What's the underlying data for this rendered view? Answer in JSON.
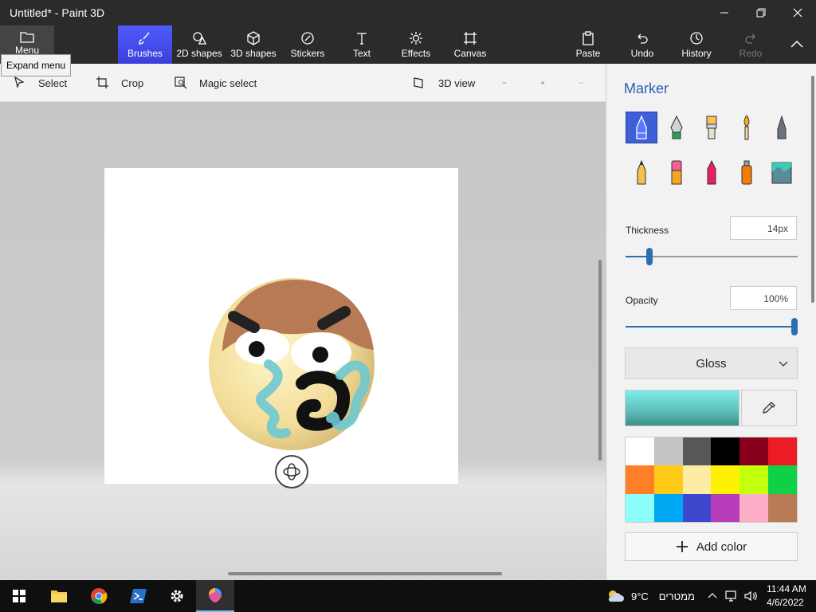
{
  "window": {
    "title": "Untitled* - Paint 3D"
  },
  "menu": {
    "label": "Menu",
    "tooltip": "Expand menu"
  },
  "ribbon": {
    "tools": [
      {
        "label": "Brushes",
        "icon": "brush-icon"
      },
      {
        "label": "2D shapes",
        "icon": "2d-shapes-icon"
      },
      {
        "label": "3D shapes",
        "icon": "3d-shapes-icon"
      },
      {
        "label": "Stickers",
        "icon": "stickers-icon"
      },
      {
        "label": "Text",
        "icon": "text-icon"
      },
      {
        "label": "Effects",
        "icon": "effects-icon"
      },
      {
        "label": "Canvas",
        "icon": "canvas-icon"
      }
    ],
    "actions": [
      {
        "label": "Paste",
        "icon": "paste-icon"
      },
      {
        "label": "Undo",
        "icon": "undo-icon"
      },
      {
        "label": "History",
        "icon": "history-icon"
      },
      {
        "label": "Redo",
        "icon": "redo-icon"
      }
    ]
  },
  "toolbar": {
    "select": "Select",
    "crop": "Crop",
    "magic_select": "Magic select",
    "view_3d": "3D view"
  },
  "panel": {
    "title": "Marker",
    "thickness_label": "Thickness",
    "thickness_value": "14px",
    "thickness_fraction": 0.14,
    "opacity_label": "Opacity",
    "opacity_value": "100%",
    "opacity_fraction": 1.0,
    "finish": "Gloss",
    "add_color": "Add color",
    "current_color": "#7eeeea",
    "palette": [
      "#ffffff",
      "#c3c3c3",
      "#585858",
      "#000000",
      "#88001b",
      "#ec1c24",
      "#ff7f27",
      "#ffca18",
      "#fdeca6",
      "#fff200",
      "#c4ff0e",
      "#0ed145",
      "#8cfffb",
      "#00a8f3",
      "#3f48cc",
      "#b83dba",
      "#ffaec8",
      "#b97a56"
    ]
  },
  "taskbar": {
    "weather": "9°C",
    "weather_desc": "ממטרים",
    "time": "11:44 AM",
    "date": "4/6/2022"
  }
}
